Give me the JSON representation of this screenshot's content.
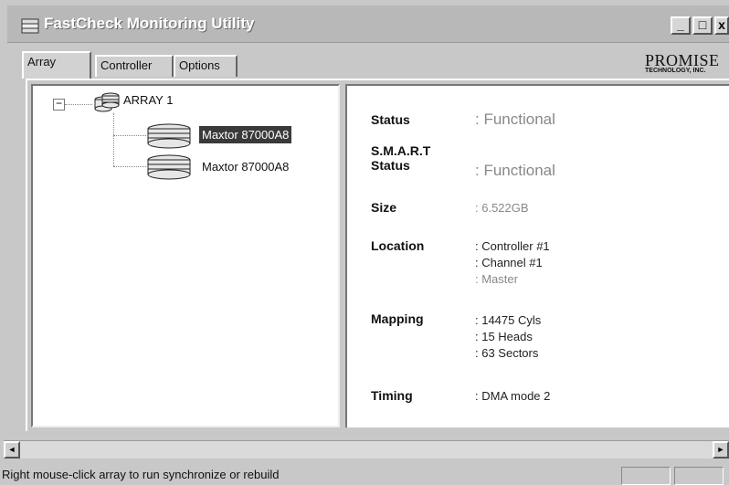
{
  "window": {
    "title": "FastCheck Monitoring Utility",
    "controls": [
      "_",
      "□",
      "x"
    ]
  },
  "tabs": [
    {
      "label": "Array",
      "active": true
    },
    {
      "label": "Controller",
      "active": false
    },
    {
      "label": "Options",
      "active": false
    }
  ],
  "brand": {
    "name": "PROMISE",
    "sub": "TECHNOLOGY, INC."
  },
  "tree": {
    "expander": "−",
    "root": "ARRAY 1",
    "drives": [
      {
        "label": "Maxtor 87000A8",
        "selected": true
      },
      {
        "label": "Maxtor 87000A8",
        "selected": false
      }
    ]
  },
  "details": {
    "status_label": "Status",
    "status_value": ": Functional",
    "smart_label_1": "S.M.A.R.T",
    "smart_label_2": "Status",
    "smart_value": ": Functional",
    "size_label": "Size",
    "size_value": ": 6.522GB",
    "location_label": "Location",
    "location_lines": [
      ": Controller #1",
      ": Channel #1",
      ": Master"
    ],
    "mapping_label": "Mapping",
    "mapping_lines": [
      ": 14475 Cyls",
      ": 15 Heads",
      ": 63 Sectors"
    ],
    "timing_label": "Timing",
    "timing_value": ": DMA mode 2"
  },
  "scrollbar": {
    "left_arrow": "◄",
    "right_arrow": "►"
  },
  "statusbar": {
    "text": "Right mouse-click array to run synchronize or rebuild"
  },
  "colors": {
    "selection": "#3a3a3a",
    "face": "#c8c8c8",
    "value_gray": "#888888"
  }
}
